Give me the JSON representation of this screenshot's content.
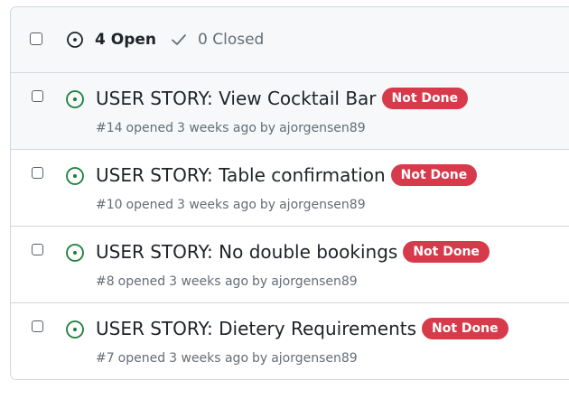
{
  "header": {
    "open_count_label": "4 Open",
    "closed_count_label": "0 Closed"
  },
  "colors": {
    "open_icon": "#1a7f37",
    "label_bg": "#d73a4a",
    "muted_text": "#656d76",
    "border": "#d0d7de"
  },
  "icons": {
    "open": "issue-opened-icon",
    "closed": "check-icon"
  },
  "issues": [
    {
      "title": "USER STORY: View Cocktail Bar",
      "label": "Not Done",
      "number": "#14",
      "opened_text": "opened",
      "time": "3 weeks ago",
      "by_text": "by",
      "author": "ajorgensen89"
    },
    {
      "title": "USER STORY: Table confirmation",
      "label": "Not Done",
      "number": "#10",
      "opened_text": "opened",
      "time": "3 weeks ago",
      "by_text": "by",
      "author": "ajorgensen89"
    },
    {
      "title": "USER STORY: No double bookings",
      "label": "Not Done",
      "number": "#8",
      "opened_text": "opened",
      "time": "3 weeks ago",
      "by_text": "by",
      "author": "ajorgensen89"
    },
    {
      "title": "USER STORY: Dietery Requirements",
      "label": "Not Done",
      "number": "#7",
      "opened_text": "opened",
      "time": "3 weeks ago",
      "by_text": "by",
      "author": "ajorgensen89"
    }
  ]
}
